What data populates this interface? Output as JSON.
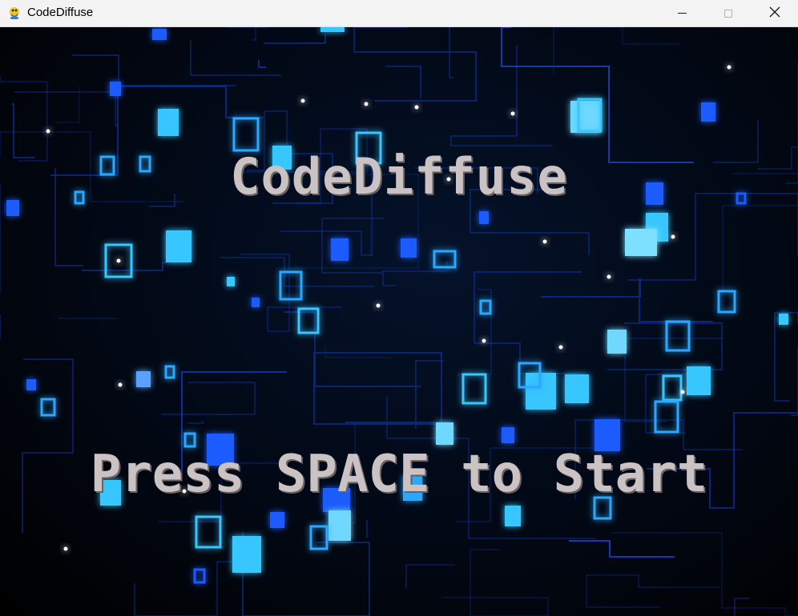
{
  "window": {
    "title": "CodeDiffuse",
    "app_icon": "python-snake-icon",
    "controls": [
      "minimize-icon",
      "maximize-icon",
      "close-icon"
    ]
  },
  "game": {
    "title": "CodeDiffuse",
    "prompt": "Press SPACE to Start",
    "text_color": "#cbc3c3",
    "background": "circuit-board-blue-glow"
  },
  "colors": {
    "accent_blue": "#1e5bff",
    "glow_cyan": "#39c6ff",
    "trace_blue": "#1a3fb8"
  }
}
